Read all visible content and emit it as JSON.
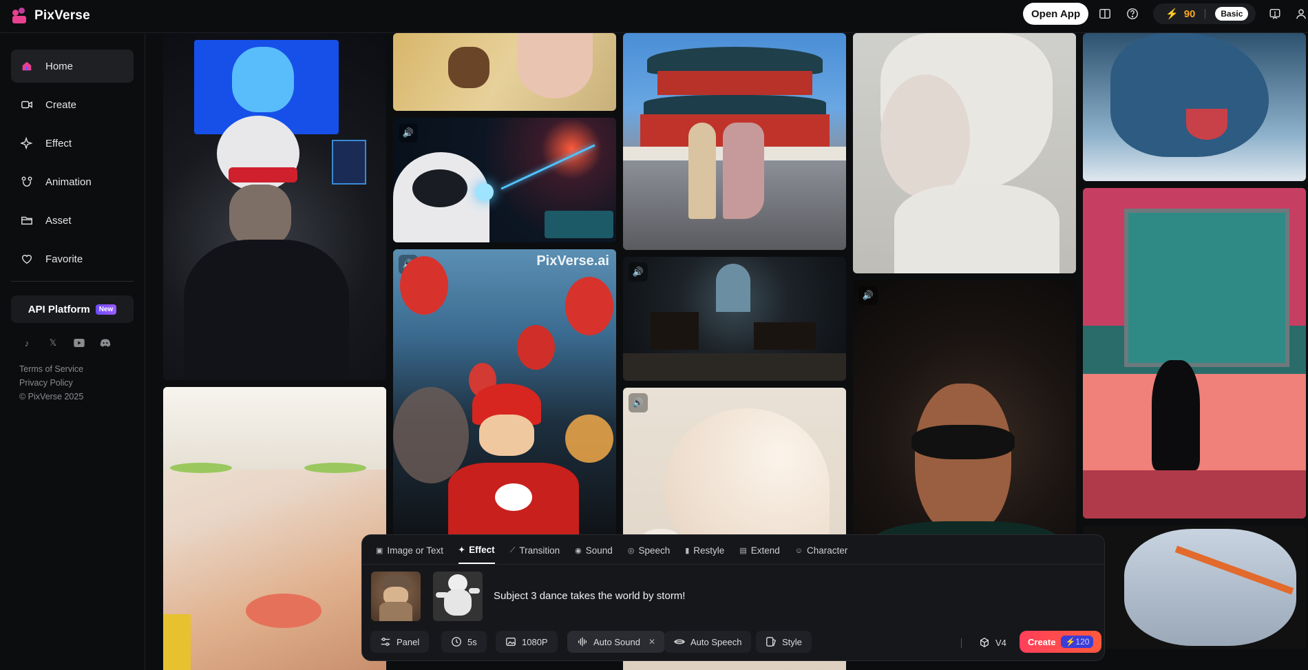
{
  "app": {
    "name": "PixVerse"
  },
  "header": {
    "open_app_label": "Open App",
    "credits": "90",
    "plan_badge": "Basic"
  },
  "sidebar": {
    "items": [
      {
        "label": "Home",
        "icon": "home-icon"
      },
      {
        "label": "Create",
        "icon": "video-camera-icon"
      },
      {
        "label": "Effect",
        "icon": "sparkle-icon"
      },
      {
        "label": "Animation",
        "icon": "animation-icon"
      },
      {
        "label": "Asset",
        "icon": "folder-icon"
      },
      {
        "label": "Favorite",
        "icon": "heart-icon"
      }
    ],
    "api_label": "API Platform",
    "api_badge": "New",
    "socials": [
      "tiktok-icon",
      "x-icon",
      "youtube-icon",
      "discord-icon"
    ],
    "legal": {
      "terms": "Terms of Service",
      "privacy": "Privacy Policy",
      "copyright": "© PixVerse 2025"
    }
  },
  "gallery": {
    "watermark": "PixVerse.ai",
    "tiles": [
      {
        "subject": "blue-haired woman portrait",
        "sound": false
      },
      {
        "subject": "woman with red sunglasses",
        "sound": false
      },
      {
        "subject": "pale-haired woman face",
        "sound": true
      },
      {
        "subject": "feet on chair",
        "sound": false
      },
      {
        "subject": "astronaut space battle",
        "sound": true
      },
      {
        "subject": "mario kart with balloons",
        "sound": true
      },
      {
        "subject": "temple of heaven women",
        "sound": false
      },
      {
        "subject": "dark gothic piano room",
        "sound": true
      },
      {
        "subject": "white fan",
        "sound": true
      },
      {
        "subject": "white sculpted face",
        "sound": false
      },
      {
        "subject": "woman with sunglasses in car",
        "sound": true
      },
      {
        "subject": "blue dragon",
        "sound": false
      },
      {
        "subject": "pixel cat under tree",
        "sound": true
      },
      {
        "subject": "airplane window wing",
        "sound": false
      }
    ]
  },
  "composer": {
    "tabs": [
      {
        "label": "Image or Text",
        "icon": "image-icon"
      },
      {
        "label": "Effect",
        "icon": "sparkle-icon",
        "active": true
      },
      {
        "label": "Transition",
        "icon": "wand-icon"
      },
      {
        "label": "Sound",
        "icon": "sound-icon"
      },
      {
        "label": "Speech",
        "icon": "speech-icon"
      },
      {
        "label": "Restyle",
        "icon": "brush-icon"
      },
      {
        "label": "Extend",
        "icon": "extend-icon"
      },
      {
        "label": "Character",
        "icon": "character-icon"
      }
    ],
    "prompt": "Subject 3 dance takes the world by storm!",
    "chips": {
      "panel": "Panel",
      "duration": "5s",
      "resolution": "1080P",
      "auto_sound": "Auto Sound",
      "auto_speech": "Auto Speech",
      "style": "Style"
    },
    "version": "V4",
    "create_label": "Create",
    "create_cost": "120"
  }
}
